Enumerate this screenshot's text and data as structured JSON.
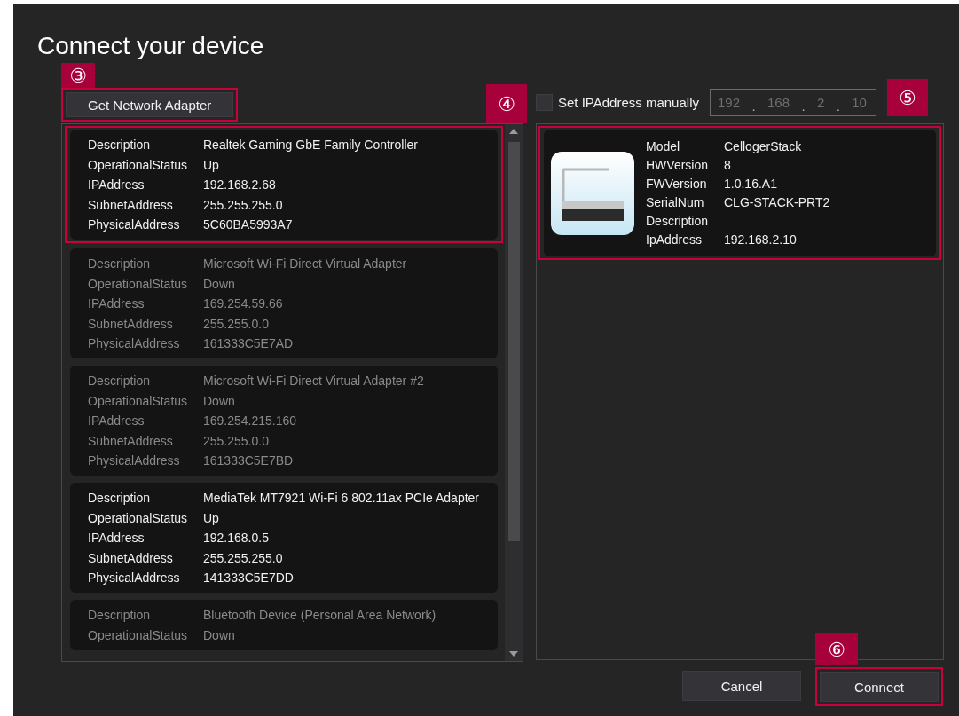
{
  "title": "Connect your device",
  "get_adapter_button": {
    "label": "Get Network Adapter",
    "callout": "③"
  },
  "adapter_list": {
    "callout": "④",
    "adapters": [
      {
        "active": true,
        "highlighted": true,
        "fields": [
          {
            "label": "Description",
            "value": "Realtek Gaming GbE Family Controller"
          },
          {
            "label": "OperationalStatus",
            "value": "Up"
          },
          {
            "label": "IPAddress",
            "value": "192.168.2.68"
          },
          {
            "label": "SubnetAddress",
            "value": "255.255.255.0"
          },
          {
            "label": "PhysicalAddress",
            "value": "5C60BA5993A7"
          }
        ]
      },
      {
        "active": false,
        "highlighted": false,
        "fields": [
          {
            "label": "Description",
            "value": "Microsoft Wi-Fi Direct Virtual Adapter"
          },
          {
            "label": "OperationalStatus",
            "value": "Down"
          },
          {
            "label": "IPAddress",
            "value": "169.254.59.66"
          },
          {
            "label": "SubnetAddress",
            "value": "255.255.0.0"
          },
          {
            "label": "PhysicalAddress",
            "value": "161333C5E7AD"
          }
        ]
      },
      {
        "active": false,
        "highlighted": false,
        "fields": [
          {
            "label": "Description",
            "value": "Microsoft Wi-Fi Direct Virtual Adapter #2"
          },
          {
            "label": "OperationalStatus",
            "value": "Down"
          },
          {
            "label": "IPAddress",
            "value": "169.254.215.160"
          },
          {
            "label": "SubnetAddress",
            "value": "255.255.0.0"
          },
          {
            "label": "PhysicalAddress",
            "value": "161333C5E7BD"
          }
        ]
      },
      {
        "active": true,
        "highlighted": false,
        "fields": [
          {
            "label": "Description",
            "value": "MediaTek MT7921 Wi-Fi 6 802.11ax PCIe Adapter"
          },
          {
            "label": "OperationalStatus",
            "value": "Up"
          },
          {
            "label": "IPAddress",
            "value": "192.168.0.5"
          },
          {
            "label": "SubnetAddress",
            "value": "255.255.255.0"
          },
          {
            "label": "PhysicalAddress",
            "value": "141333C5E7DD"
          }
        ]
      },
      {
        "active": false,
        "highlighted": false,
        "fields": [
          {
            "label": "Description",
            "value": "Bluetooth Device (Personal Area Network)"
          },
          {
            "label": "OperationalStatus",
            "value": "Down"
          }
        ]
      }
    ]
  },
  "manual_ip": {
    "label": "Set IPAddress manually",
    "checked": false,
    "octets": [
      "192",
      "168",
      "2",
      "10"
    ],
    "separator": ".",
    "callout": "⑤"
  },
  "device": {
    "highlighted": true,
    "fields": [
      {
        "label": "Model",
        "value": "CellogerStack"
      },
      {
        "label": "HWVersion",
        "value": "8"
      },
      {
        "label": "FWVersion",
        "value": "1.0.16.A1"
      },
      {
        "label": "SerialNum",
        "value": "CLG-STACK-PRT2"
      },
      {
        "label": "Description"
      },
      {
        "label": "IpAddress",
        "value": "192.168.2.10"
      }
    ]
  },
  "buttons": [
    {
      "label": "Cancel"
    },
    {
      "label": "Connect",
      "callout": "⑥"
    }
  ]
}
